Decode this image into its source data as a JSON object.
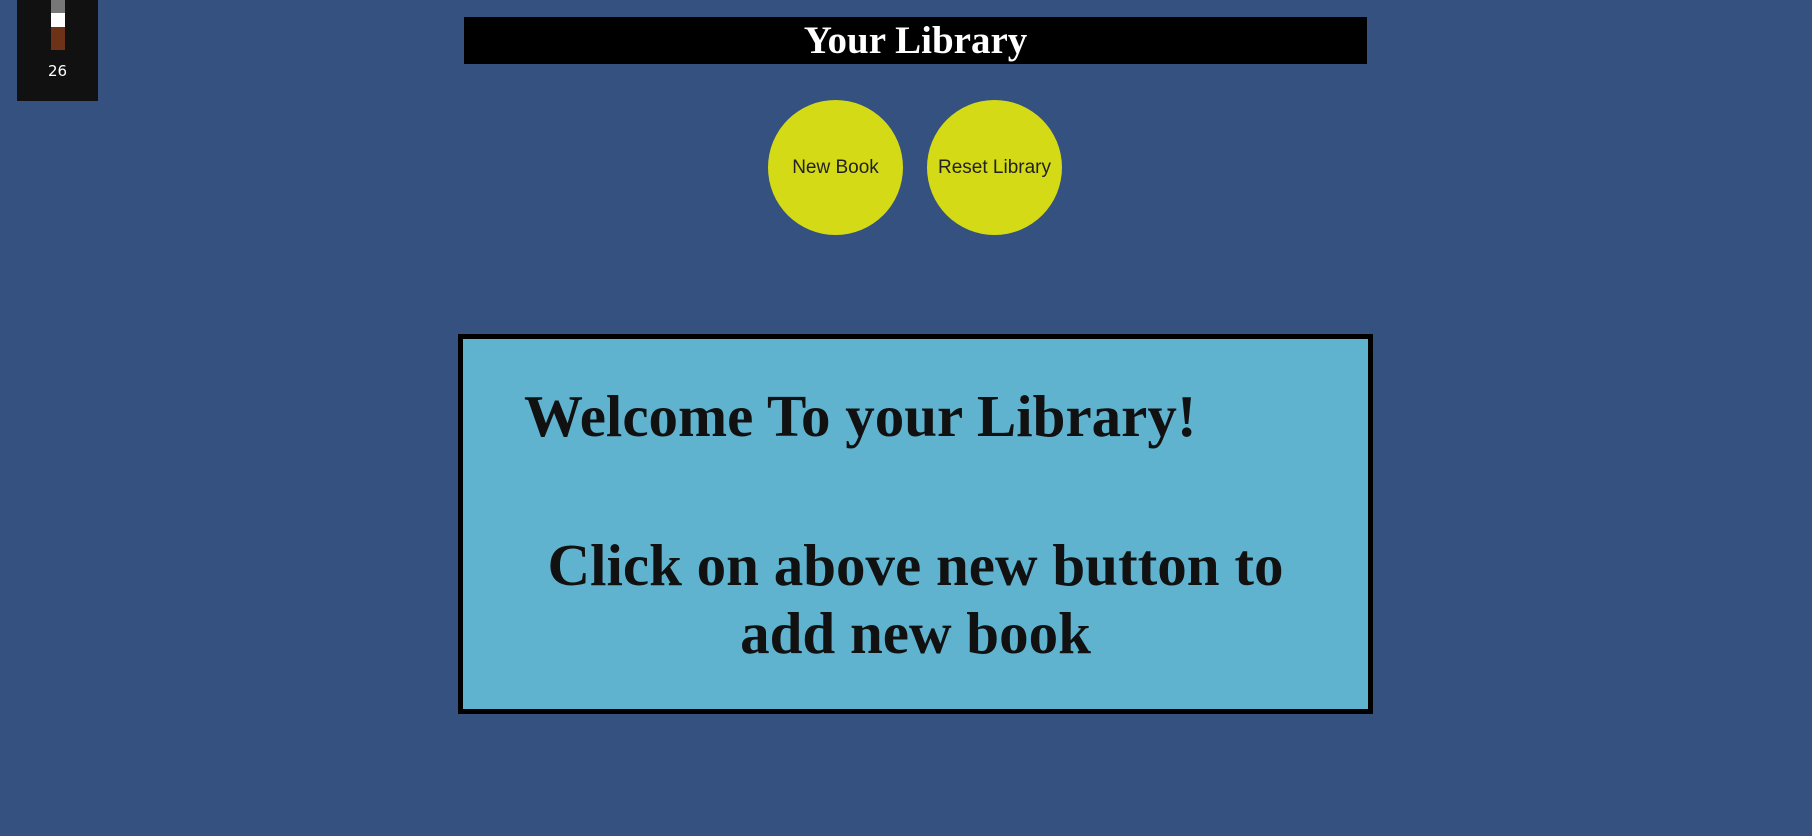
{
  "widget": {
    "count": "26",
    "colors": [
      "#777777",
      "#ffffff",
      "#6e3219"
    ]
  },
  "header": {
    "title": "Your Library"
  },
  "buttons": {
    "new_book": "New Book",
    "reset_library": "Reset Library"
  },
  "welcome": {
    "heading": "Welcome To your Library!",
    "line1": "Click on above new button to",
    "line2": "add new book"
  },
  "colors": {
    "background": "#34517f",
    "title_bar": "#000000",
    "button": "#d4db16",
    "card": "#60b3cf"
  }
}
